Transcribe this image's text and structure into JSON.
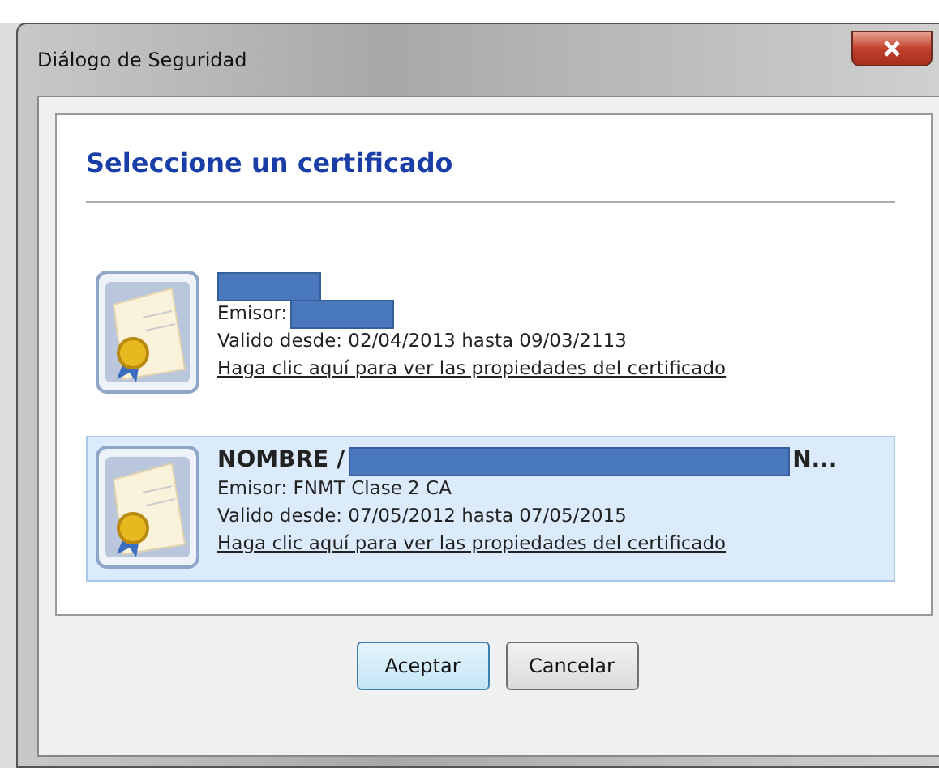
{
  "window": {
    "title": "Diálogo de Seguridad"
  },
  "heading": "Seleccione un certificado",
  "certificates": [
    {
      "selected": false,
      "issuer": "Emisor:",
      "issuer_redacted": true,
      "validity": "Valido desde: 02/04/2013 hasta 09/03/2113",
      "link": "Haga clic aquí para ver las propiedades del certificado"
    },
    {
      "selected": true,
      "name_prefix": "NOMBRE /",
      "name_suffix": "N...",
      "issuer": "Emisor: FNMT Clase 2 CA",
      "issuer_redacted": false,
      "validity": "Valido desde: 07/05/2012 hasta 07/05/2015",
      "link": "Haga clic aquí para ver las propiedades del certificado"
    }
  ],
  "buttons": [
    {
      "label": "Aceptar",
      "default": true
    },
    {
      "label": "Cancelar",
      "default": false
    }
  ]
}
